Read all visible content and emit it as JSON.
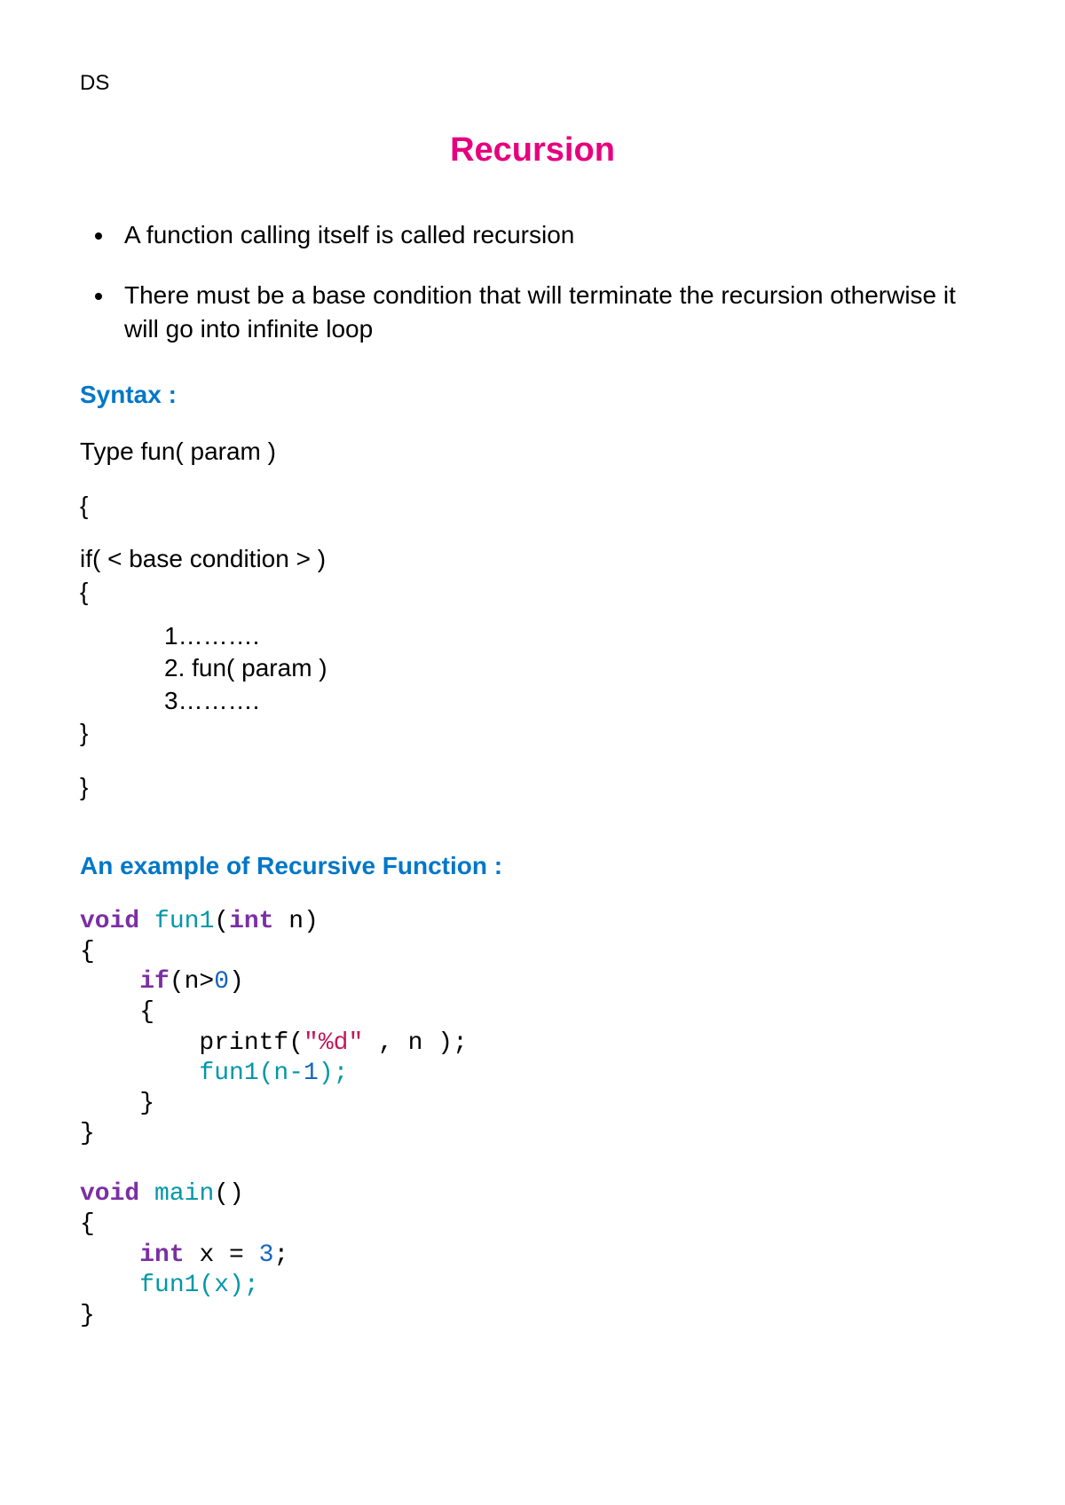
{
  "header": {
    "label": "DS"
  },
  "title": "Recursion",
  "bullets": [
    "A function calling itself is called recursion",
    "There must be a base condition that will terminate the recursion otherwise it will go into infinite loop"
  ],
  "syntax": {
    "heading": "Syntax :",
    "line1": "Type fun( param )",
    "brace_open1": "{",
    "cond": "if( < base condition > )",
    "brace_open2": "{",
    "step1": "1……….",
    "step2": "2. fun( param )",
    "step3": "3……….",
    "brace_close2": "}",
    "brace_close1": "}"
  },
  "example": {
    "heading": "An example of Recursive Function :",
    "code": {
      "t_void": "void",
      "t_fun1": "fun1",
      "t_int": "int",
      "t_n": "n",
      "t_if": "if",
      "t_gt0_open": "(n>",
      "t_zero": "0",
      "t_gt0_close": ")",
      "t_printf": "printf(",
      "t_fmt": "\"%d\"",
      "t_printf_tail": " , n );",
      "t_fun1call_open": "fun1(n-",
      "t_one": "1",
      "t_fun1call_close": ");",
      "t_main": "main",
      "t_intx": "int",
      "t_x_eq": " x = ",
      "t_three": "3",
      "t_semi": ";",
      "t_fun1x": "fun1(x);",
      "brace_open": "{",
      "brace_close": "}",
      "paren_open": "(",
      "paren_close": ")",
      "space": " "
    }
  }
}
